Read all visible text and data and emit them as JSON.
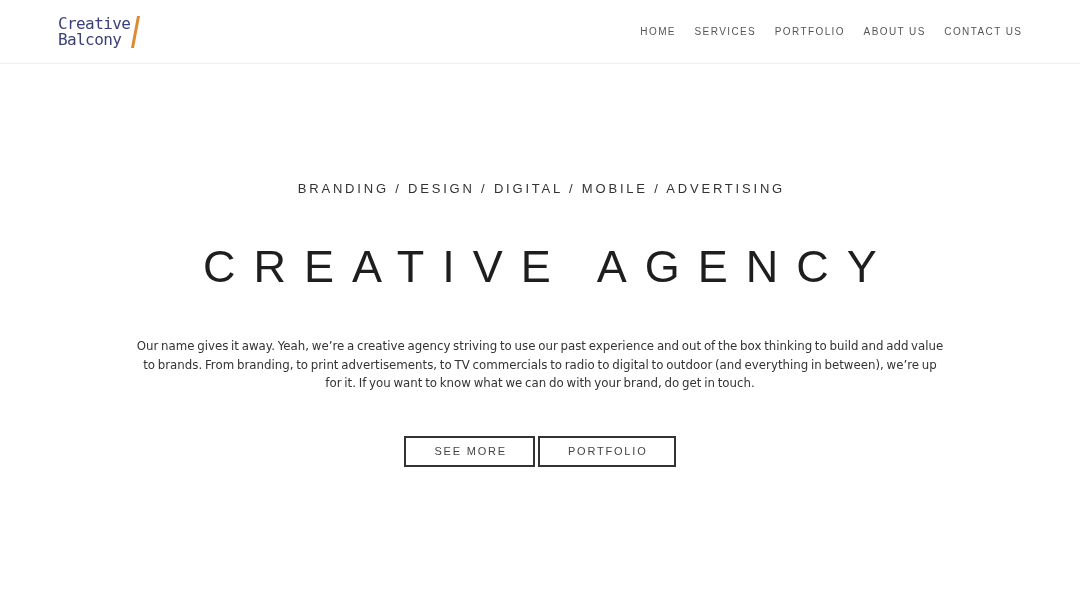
{
  "header": {
    "logo": {
      "lines": [
        "Creative",
        "Balcony"
      ]
    },
    "nav": [
      {
        "label": "HOME"
      },
      {
        "label": "SERVICES"
      },
      {
        "label": "PORTFOLIO"
      },
      {
        "label": "ABOUT US"
      },
      {
        "label": "CONTACT US"
      }
    ]
  },
  "hero": {
    "tagline": "BRANDING / DESIGN / DIGITAL / MOBILE / ADVERTISING",
    "title": "CREATIVE AGENCY",
    "description": "Our name gives it away. Yeah, we’re a creative agency striving to use our past experience and out of the box thinking to build and add value to brands. From branding, to print advertisements, to TV commercials to radio to digital to outdoor (and everything in between), we’re up for it. If you want to know what we can do with your brand, do get in touch.",
    "buttons": [
      {
        "label": "SEE MORE"
      },
      {
        "label": "PORTFOLIO"
      }
    ]
  }
}
